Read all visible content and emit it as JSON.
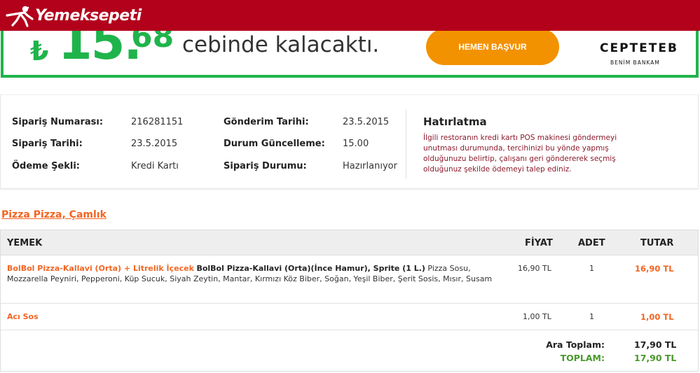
{
  "header": {
    "logo_text": "Yemeksepeti",
    "colors": {
      "background": "#b3001b",
      "text": "#ffffff"
    }
  },
  "banner": {
    "currency_symbol": "₺",
    "amount_whole": "15.",
    "amount_cents": "68",
    "text": "cebinde kalacaktı.",
    "button_label": "HEMEN BAŞVUR",
    "brand": "CEPTETEB",
    "brand_tagline": "BENİM BANKAM",
    "colors": {
      "accent": "#1fb44b",
      "button": "#f39200"
    }
  },
  "order_info": {
    "labels": {
      "order_number": "Sipariş Numarası:",
      "order_date": "Sipariş Tarihi:",
      "payment_method": "Ödeme Şekli:",
      "delivery_date": "Gönderim Tarihi:",
      "status_update": "Durum Güncelleme:",
      "order_status": "Sipariş Durumu:"
    },
    "values": {
      "order_number": "216281151",
      "order_date": "23.5.2015",
      "payment_method": "Kredi Kartı",
      "delivery_date": "23.5.2015",
      "status_update": "15.00",
      "order_status": "Hazırlanıyor"
    }
  },
  "reminder": {
    "title": "Hatırlatma",
    "text": "İlgili restoranın kredi kartı POS makinesi göndermeyi unutması durumunda, tercihinizi bu yönde yapmış olduğunuzu belirtip, çalışanı geri göndererek seçmiş olduğunuz şekilde ödemeyi talep ediniz."
  },
  "restaurant": {
    "name": "Pizza Pizza, Çamlık"
  },
  "table": {
    "headers": {
      "item": "YEMEK",
      "price": "FİYAT",
      "quantity": "ADET",
      "total": "TUTAR"
    },
    "rows": [
      {
        "name": "BolBol Pizza-Kallavi (Orta) + Litrelik İçecek",
        "main": "BolBol Pizza-Kallavi (Orta)(İnce Hamur), Sprite (1 L.)",
        "details": "Pizza Sosu, Mozzarella Peyniri, Pepperoni, Küp Sucuk, Siyah Zeytin, Mantar, Kırmızı Köz Biber, Soğan, Yeşil Biber, Şerit Sosis, Mısır, Susam",
        "price": "16,90 TL",
        "quantity": "1",
        "total": "16,90 TL"
      },
      {
        "name": "Acı Sos",
        "main": "",
        "details": "",
        "price": "1,00 TL",
        "quantity": "1",
        "total": "1,00 TL"
      }
    ],
    "subtotal_label": "Ara Toplam:",
    "subtotal_value": "17,90 TL",
    "grand_total_label": "TOPLAM:",
    "grand_total_value": "17,90 TL"
  }
}
